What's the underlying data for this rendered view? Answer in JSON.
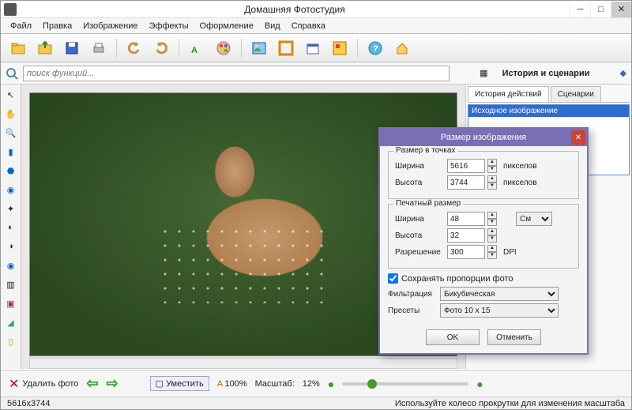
{
  "titlebar": {
    "title": "Домашняя Фотостудия"
  },
  "menu": [
    "Файл",
    "Правка",
    "Изображение",
    "Эффекты",
    "Оформление",
    "Вид",
    "Справка"
  ],
  "search": {
    "placeholder": "поиск функций..."
  },
  "history": {
    "panel_label": "История и сценарии",
    "tab_history": "История действий",
    "tab_scenarios": "Сценарии",
    "item0": "Исходное изображение"
  },
  "bottom": {
    "delete": "Удалить фото",
    "fit": "Уместить",
    "zoom100": "100%",
    "scale_label": "Масштаб:",
    "scale_value": "12%"
  },
  "status": {
    "dims": "5616x3744",
    "hint": "Используйте колесо прокрутки для изменения масштаба"
  },
  "dialog": {
    "title": "Размер изображения",
    "grp_pixels": "Размер в точках",
    "grp_print": "Печатный размер",
    "width_label": "Ширина",
    "height_label": "Высота",
    "res_label": "Разрешение",
    "width_px": "5616",
    "height_px": "3744",
    "px_unit": "пикселов",
    "width_cm": "48",
    "height_cm": "32",
    "cm_unit": "См",
    "dpi": "300",
    "dpi_unit": "DPI",
    "keep_ratio": "Сохранять пропорции фото",
    "filter_label": "Фильтрация",
    "filter_val": "Бикубическая",
    "preset_label": "Пресеты",
    "preset_val": "Фото 10 x 15",
    "ok": "OK",
    "cancel": "Отменить"
  }
}
